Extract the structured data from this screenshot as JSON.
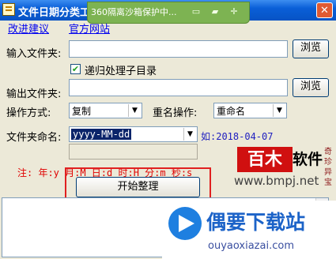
{
  "window": {
    "title": "文件日期分类工",
    "sandbox_text": "360隔离沙箱保护中..."
  },
  "links": {
    "suggest": "改进建议",
    "official": "官方网站"
  },
  "input_folder": {
    "label": "输入文件夹:",
    "value": "",
    "browse_label": "浏览"
  },
  "recursive": {
    "label": "递归处理子目录",
    "checked": true
  },
  "output_folder": {
    "label": "输出文件夹:",
    "value": "",
    "browse_label": "浏览"
  },
  "operation": {
    "label": "操作方式:",
    "value": "复制"
  },
  "rename": {
    "label": "重名操作:",
    "value": "重命名"
  },
  "folder_naming": {
    "label": "文件夹命名:",
    "value": "yyyy-MM-dd",
    "example": "如:2018-04-07",
    "extra_value": ""
  },
  "hint": "注: 年:y 月:M 日:d 时:H 分:m 秒:s",
  "start_button": "开始整理",
  "watermark": {
    "logo_main": "百木软件",
    "logo_side": "奇珍异宝",
    "url": "www.bmpj.net",
    "site_name": "偶要下载站",
    "site_url": "ouyaoxiazai.com"
  },
  "colors": {
    "titlebar": "#0a5fd8",
    "sandbox": "#7db352",
    "hint_red": "#e00000",
    "highlight_box": "#e02020"
  }
}
